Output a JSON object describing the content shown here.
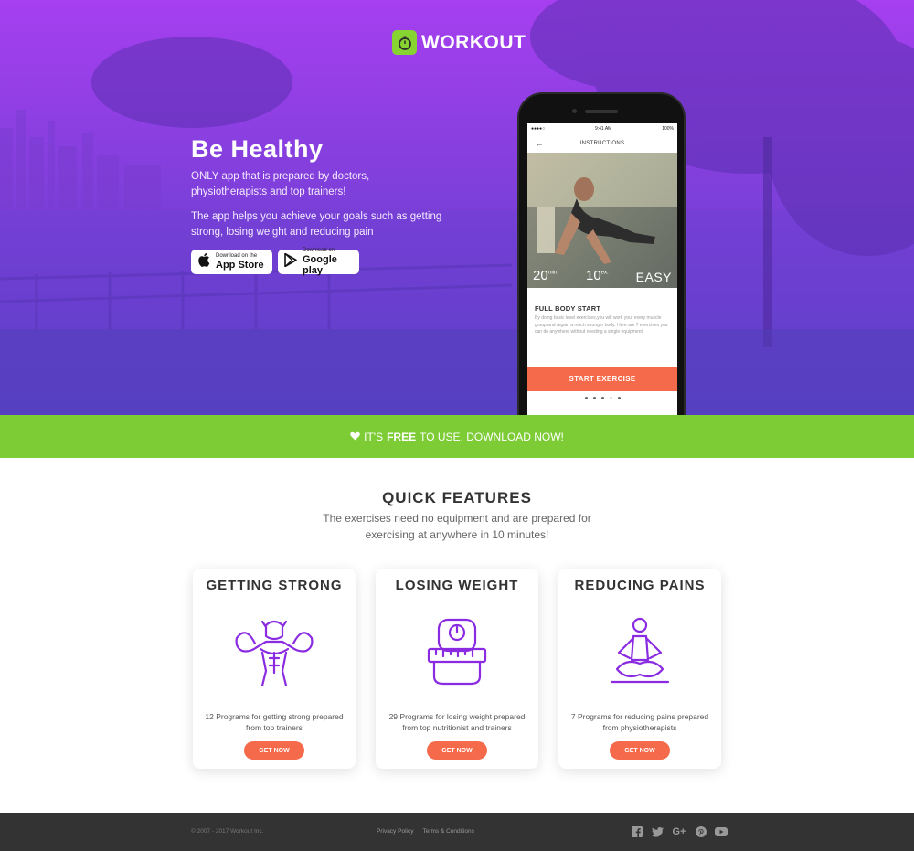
{
  "brand": {
    "name": "WORKOUT",
    "accent": "#86d331",
    "primary": "#8d3fe2",
    "cta_color": "#f56a4b"
  },
  "hero": {
    "title": "Be Healthy",
    "paragraph1": "ONLY app that is prepared by doctors, physiotherapists and top trainers!",
    "paragraph2": "The app helps you achieve your goals such as getting strong, losing weight and reducing pain",
    "app_store": {
      "small": "Download on the",
      "big": "App Store",
      "icon": "apple-icon"
    },
    "google_play": {
      "small": "Download on",
      "big": "Google play",
      "icon": "play-triangle-icon"
    }
  },
  "phone": {
    "status_time": "9:41 AM",
    "battery": "100%",
    "screen_title": "INSTRUCTIONS",
    "duration_value": "20",
    "duration_unit": "min.",
    "exercises_value": "10",
    "exercises_unit": "ex.",
    "difficulty": "EASY",
    "workout_title": "FULL BODY START",
    "workout_desc": "By doing basic level exercises,you will work your every muscle group and regain a much stronger body. Here are 7 exercises you can do anywhere without needing a single equipment.",
    "start_label": "START EXERCISE"
  },
  "banner": {
    "prefix": "IT'S",
    "bold": "FREE",
    "suffix": "TO USE. DOWNLOAD NOW!",
    "icon": "heart-icon"
  },
  "features": {
    "title": "QUICK FEATURES",
    "subtitle": "The exercises need no equipment and are prepared for exercising at anywhere in 10 minutes!",
    "cards": [
      {
        "title": "GETTING STRONG",
        "desc": "12 Programs for getting strong prepared from top trainers",
        "button": "GET NOW",
        "icon": "muscle-man-icon"
      },
      {
        "title": "LOSING WEIGHT",
        "desc": "29 Programs for losing weight prepared from top nutritionist and trainers",
        "button": "GET NOW",
        "icon": "scale-tape-icon"
      },
      {
        "title": "REDUCING PAINS",
        "desc": "7 Programs for reducing pains prepared from physiotherapists",
        "button": "GET NOW",
        "icon": "meditation-icon"
      }
    ]
  },
  "footer": {
    "copyright": "© 2007 - 2017 Workout Inc.",
    "links": [
      "Privacy Policy",
      "Terms & Conditions"
    ],
    "social": [
      "facebook-icon",
      "twitter-icon",
      "google-plus-icon",
      "pinterest-icon",
      "youtube-icon"
    ]
  }
}
